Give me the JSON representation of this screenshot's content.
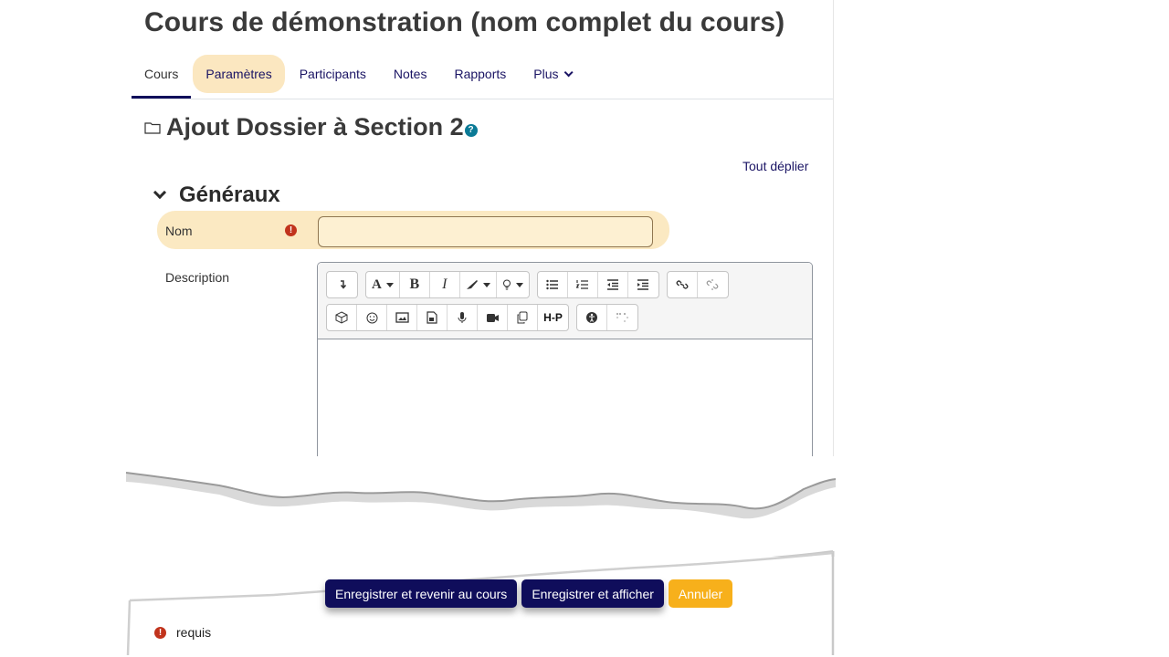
{
  "course": {
    "title": "Cours de démonstration (nom complet du cours)"
  },
  "tabs": [
    {
      "label": "Cours"
    },
    {
      "label": "Paramètres"
    },
    {
      "label": "Participants"
    },
    {
      "label": "Notes"
    },
    {
      "label": "Rapports"
    },
    {
      "label": "Plus"
    }
  ],
  "heading": {
    "text": "Ajout Dossier à Section 2",
    "help_symbol": "?"
  },
  "expand_all": "Tout déplier",
  "section": {
    "title": "Généraux"
  },
  "form": {
    "name_label": "Nom",
    "name_value": "",
    "required_symbol": "!",
    "description_label": "Description"
  },
  "editor": {
    "toolbar_row1": [
      [
        "collapse-icon"
      ],
      [
        "font-style-icon",
        "bold-icon",
        "italic-icon",
        "highlight-icon",
        "lightbulb-icon"
      ],
      [
        "bullet-list-icon",
        "numbered-list-icon",
        "outdent-icon",
        "indent-icon"
      ],
      [
        "link-icon",
        "unlink-icon"
      ]
    ],
    "toolbar_row2": [
      [
        "box-icon",
        "emoji-icon",
        "image-icon",
        "media-icon",
        "microphone-icon",
        "video-icon",
        "copy-icon",
        "h5p-icon"
      ],
      [
        "accessibility-icon",
        "braille-icon"
      ]
    ],
    "labels": {
      "font": "A",
      "bold": "B",
      "italic": "I",
      "h5p": "H-P"
    }
  },
  "buttons": {
    "save_return": "Enregistrer et revenir au cours",
    "save_display": "Enregistrer et afficher",
    "cancel": "Annuler"
  },
  "required_note": "requis",
  "colors": {
    "primary": "#0f0d5b",
    "highlight": "#fbe7c0",
    "cancel": "#f7b01b",
    "required": "#c1331c"
  }
}
